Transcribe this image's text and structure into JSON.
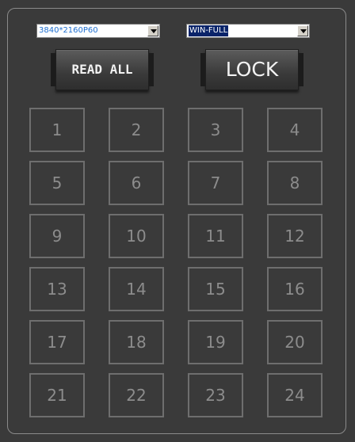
{
  "resolution_select": {
    "value": "3840*2160P60"
  },
  "mode_select": {
    "value": "WIN-FULL"
  },
  "buttons": {
    "read_all": "READ ALL",
    "lock": "LOCK"
  },
  "channels": [
    "1",
    "2",
    "3",
    "4",
    "5",
    "6",
    "7",
    "8",
    "9",
    "10",
    "11",
    "12",
    "13",
    "14",
    "15",
    "16",
    "17",
    "18",
    "19",
    "20",
    "21",
    "22",
    "23",
    "24"
  ],
  "colors": {
    "background": "#3a3a3a",
    "panel_border": "#8a8a8a",
    "channel_border": "#6e6e6e",
    "channel_text": "#8c8c8c",
    "resolution_text": "#1e6fd1",
    "selection_highlight": "#0a246a"
  }
}
